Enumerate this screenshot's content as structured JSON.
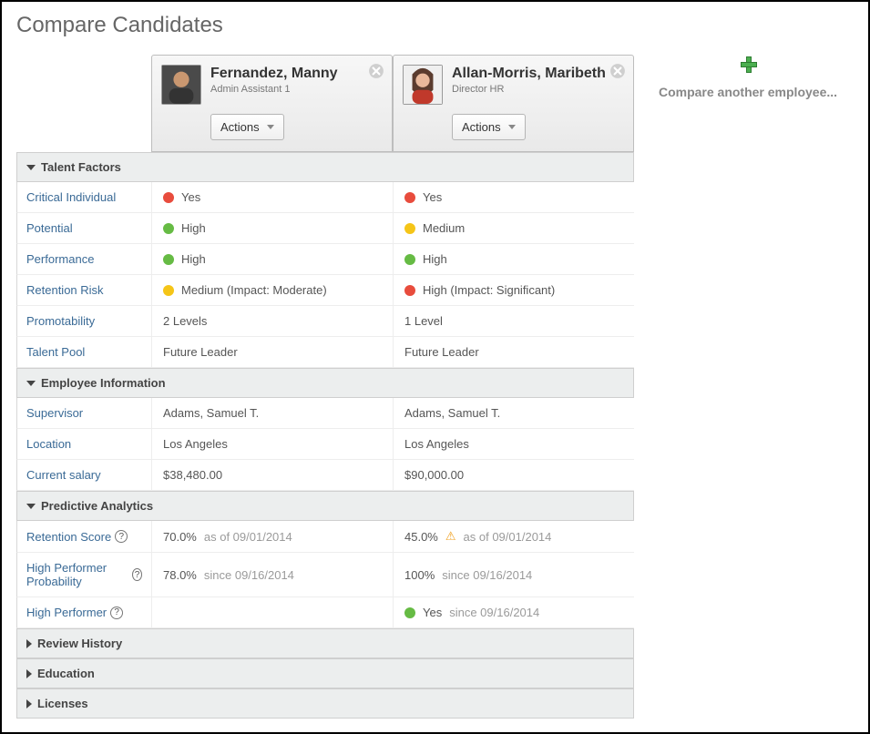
{
  "page": {
    "title": "Compare Candidates"
  },
  "addPanel": {
    "label": "Compare another employee..."
  },
  "candidates": [
    {
      "name": "Fernandez, Manny",
      "title": "Admin Assistant 1",
      "actionsLabel": "Actions"
    },
    {
      "name": "Allan-Morris, Maribeth",
      "title": "Director HR",
      "actionsLabel": "Actions"
    }
  ],
  "sections": {
    "talentFactors": {
      "title": "Talent Factors",
      "rows": {
        "criticalIndividual": {
          "label": "Critical Individual",
          "c0": {
            "dot": "red",
            "text": "Yes"
          },
          "c1": {
            "dot": "red",
            "text": "Yes"
          }
        },
        "potential": {
          "label": "Potential",
          "c0": {
            "dot": "green",
            "text": "High"
          },
          "c1": {
            "dot": "yellow",
            "text": "Medium"
          }
        },
        "performance": {
          "label": "Performance",
          "c0": {
            "dot": "green",
            "text": "High"
          },
          "c1": {
            "dot": "green",
            "text": "High"
          }
        },
        "retentionRisk": {
          "label": "Retention Risk",
          "c0": {
            "dot": "yellow",
            "text": "Medium (Impact: Moderate)"
          },
          "c1": {
            "dot": "red",
            "text": "High (Impact: Significant)"
          }
        },
        "promotability": {
          "label": "Promotability",
          "c0": {
            "text": "2 Levels"
          },
          "c1": {
            "text": "1 Level"
          }
        },
        "talentPool": {
          "label": "Talent Pool",
          "c0": {
            "text": "Future Leader"
          },
          "c1": {
            "text": "Future Leader"
          }
        }
      }
    },
    "employeeInfo": {
      "title": "Employee Information",
      "rows": {
        "supervisor": {
          "label": "Supervisor",
          "c0": "Adams, Samuel T.",
          "c1": "Adams, Samuel T."
        },
        "location": {
          "label": "Location",
          "c0": "Los Angeles",
          "c1": "Los Angeles"
        },
        "currentSalary": {
          "label": "Current salary",
          "c0": "$38,480.00",
          "c1": "$90,000.00"
        }
      }
    },
    "predictive": {
      "title": "Predictive Analytics",
      "rows": {
        "retentionScore": {
          "label": "Retention Score",
          "c0": {
            "val": "70.0%",
            "note": "as of 09/01/2014"
          },
          "c1": {
            "val": "45.0%",
            "warn": true,
            "note": "as of 09/01/2014"
          }
        },
        "hpProb": {
          "label": "High Performer Probability",
          "c0": {
            "val": "78.0%",
            "note": "since 09/16/2014"
          },
          "c1": {
            "val": "100%",
            "note": "since 09/16/2014"
          }
        },
        "highPerformer": {
          "label": "High Performer",
          "c0": {},
          "c1": {
            "dot": "green",
            "val": "Yes",
            "note": "since 09/16/2014"
          }
        }
      }
    },
    "reviewHistory": {
      "title": "Review History"
    },
    "education": {
      "title": "Education"
    },
    "licenses": {
      "title": "Licenses"
    }
  }
}
